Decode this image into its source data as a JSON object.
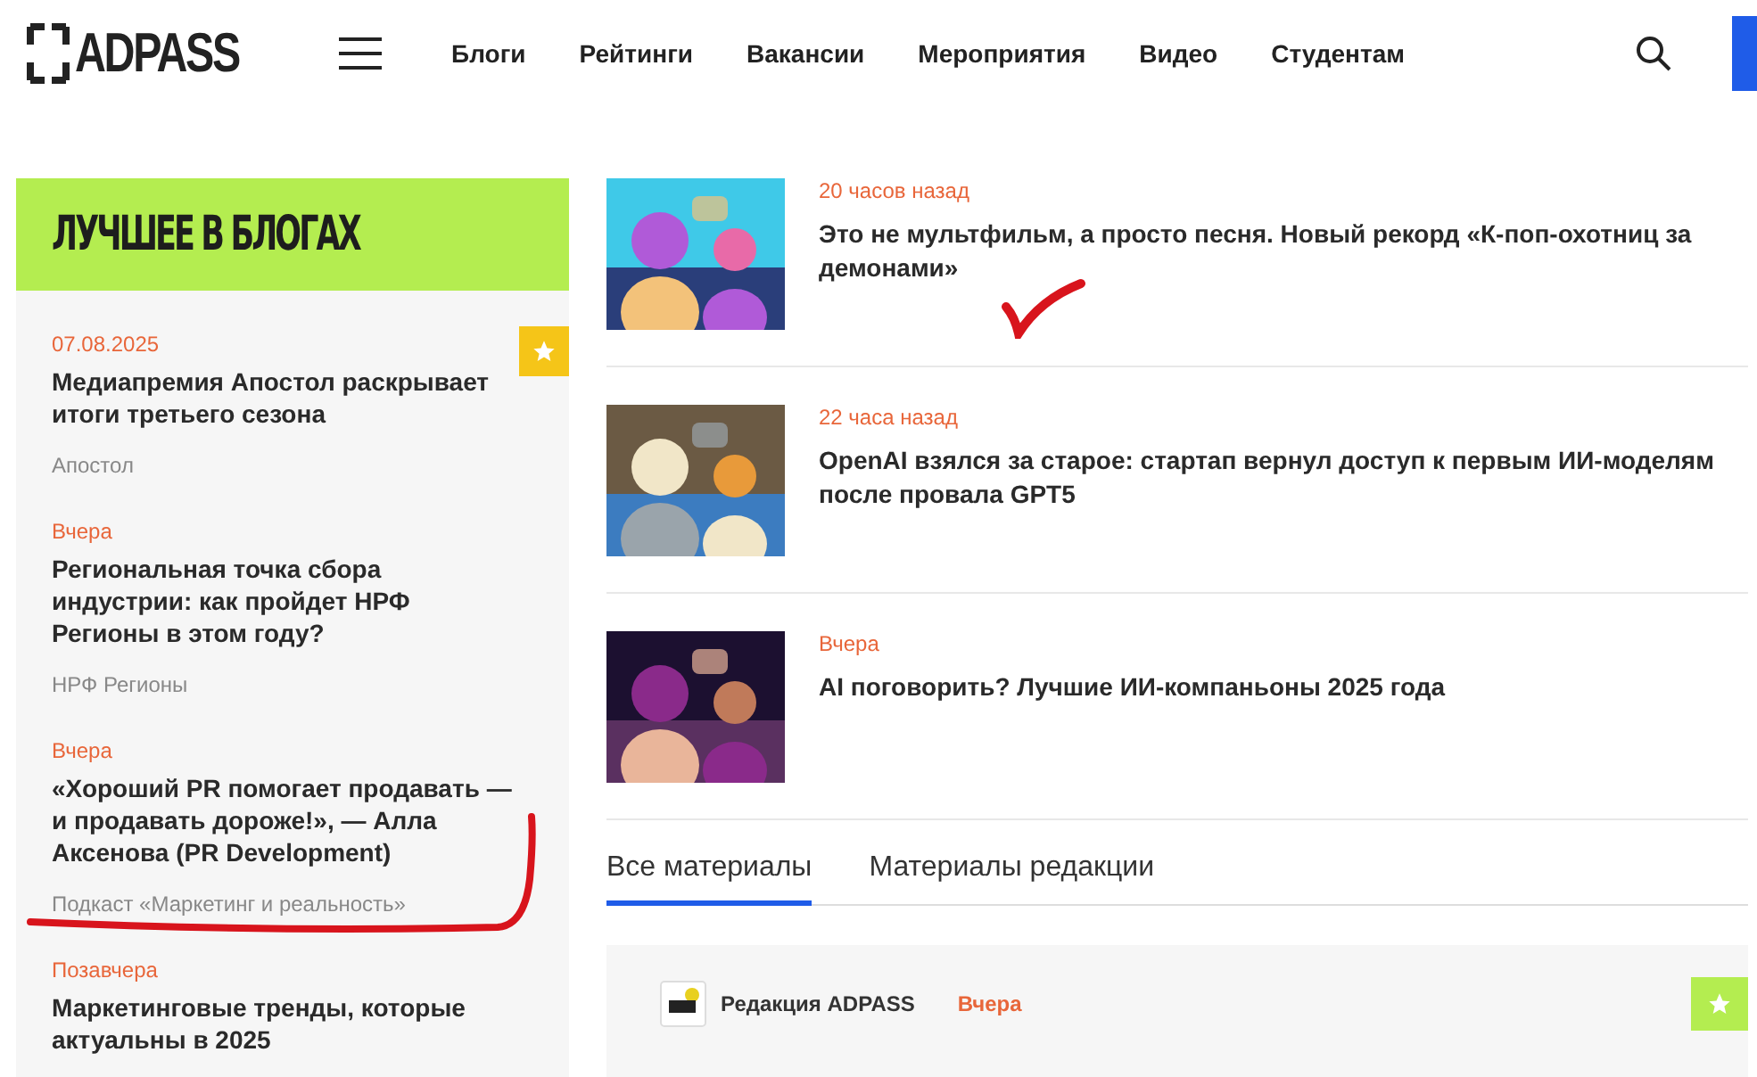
{
  "header": {
    "logo": "ADPASS",
    "nav": [
      "Блоги",
      "Рейтинги",
      "Вакансии",
      "Мероприятия",
      "Видео",
      "Студентам"
    ]
  },
  "sidebar": {
    "title": "ЛУЧШЕЕ В БЛОГАХ",
    "posts": [
      {
        "date": "07.08.2025",
        "title": "Медиапремия Апостол раскрывает итоги третьего сезона",
        "source": "Апостол",
        "starred": true
      },
      {
        "date": "Вчера",
        "title": "Региональная точка сбора индустрии: как пройдет НРФ Регионы в этом году?",
        "source": "НРФ Регионы",
        "starred": false
      },
      {
        "date": "Вчера",
        "title": "«Хороший PR помогает продавать — и продавать дороже!», — Алла Аксенова (PR Development)",
        "source": "Подкаст «Маркетинг и реальность»",
        "starred": false
      },
      {
        "date": "Позавчера",
        "title": "Маркетинговые тренды, которые актуальны в 2025",
        "starred": false
      }
    ]
  },
  "articles": [
    {
      "time": "20 часов назад",
      "title": "Это не мультфильм, а просто песня. Новый рекорд «К-поп-охотниц за демонами»",
      "kind": "picture"
    },
    {
      "time": "22 часа назад",
      "title": "OpenAI взялся за старое: стартап вернул доступ к первым ИИ-моделям после провала GPT5",
      "kind": "picture"
    },
    {
      "time": "Вчера",
      "title": "AI поговорить? Лучшие ИИ-компаньоны 2025 года",
      "kind": "picture"
    }
  ],
  "tabs": [
    {
      "label": "Все материалы",
      "selected": true
    },
    {
      "label": "Материалы редакции",
      "selected": false
    }
  ],
  "feed_card": {
    "author": "Редакция ADPASS",
    "time": "Вчера",
    "starred": true
  }
}
